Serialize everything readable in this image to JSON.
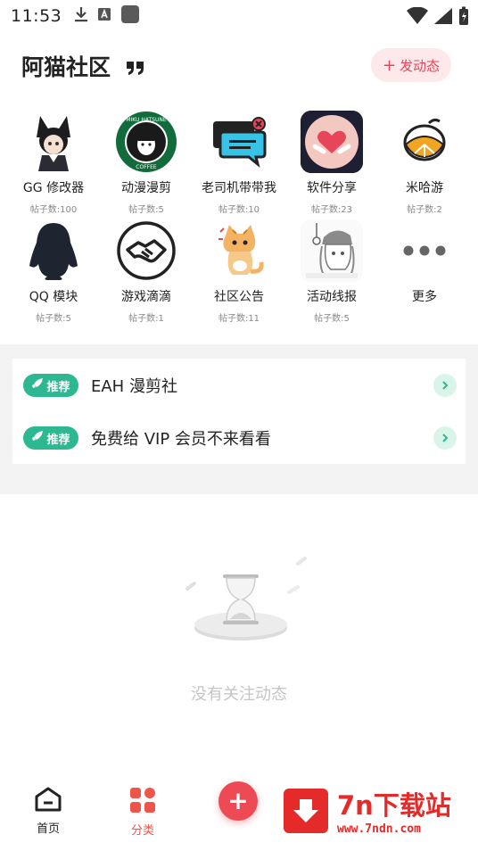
{
  "status_bar": {
    "time": "11:53",
    "icons_left": [
      "download-icon",
      "font-icon",
      "app-icon"
    ],
    "icons_right": [
      "wifi-icon",
      "signal-icon",
      "battery-icon"
    ]
  },
  "header": {
    "title": "阿猫社区",
    "post_button": {
      "plus": "+",
      "label": "发动态"
    }
  },
  "categories": [
    {
      "label": "GG 修改器",
      "count": "帖子数:100",
      "icon": "anime-girl-icon"
    },
    {
      "label": "动漫漫剪",
      "count": "帖子数:5",
      "icon": "miku-coffee-icon"
    },
    {
      "label": "老司机带带我",
      "count": "帖子数:10",
      "icon": "chat-bubble-icon"
    },
    {
      "label": "软件分享",
      "count": "帖子数:23",
      "icon": "hearts-icon"
    },
    {
      "label": "米哈游",
      "count": "帖子数:2",
      "icon": "lemon-icon"
    },
    {
      "label": "QQ 模块",
      "count": "帖子数:5",
      "icon": "qq-penguin-icon"
    },
    {
      "label": "游戏滴滴",
      "count": "帖子数:1",
      "icon": "handshake-icon"
    },
    {
      "label": "社区公告",
      "count": "帖子数:11",
      "icon": "cat-icon"
    },
    {
      "label": "活动线报",
      "count": "帖子数:5",
      "icon": "manga-girl-icon"
    },
    {
      "label": "更多",
      "count": "",
      "icon": "more-dots-icon"
    }
  ],
  "recommend": {
    "badge_label": "推荐",
    "items": [
      {
        "text": "EAH 漫剪社"
      },
      {
        "text": "免费给 VIP 会员不来看看"
      }
    ]
  },
  "empty_state": {
    "text": "没有关注动态",
    "icon": "hourglass-icon"
  },
  "bottom_nav": {
    "items": [
      {
        "label": "首页",
        "icon": "home-icon",
        "active": false
      },
      {
        "label": "分类",
        "icon": "category-grid-icon",
        "active": true
      }
    ],
    "fab_label": "+"
  },
  "watermark": {
    "title": "7n下载站",
    "url": "www.7ndn.com"
  },
  "colors": {
    "accent_red": "#ee4a55",
    "post_button_bg": "#fde8ea",
    "recommend_green": "#2db892",
    "nav_active": "#f0554b",
    "watermark_red": "#e52a2a"
  }
}
